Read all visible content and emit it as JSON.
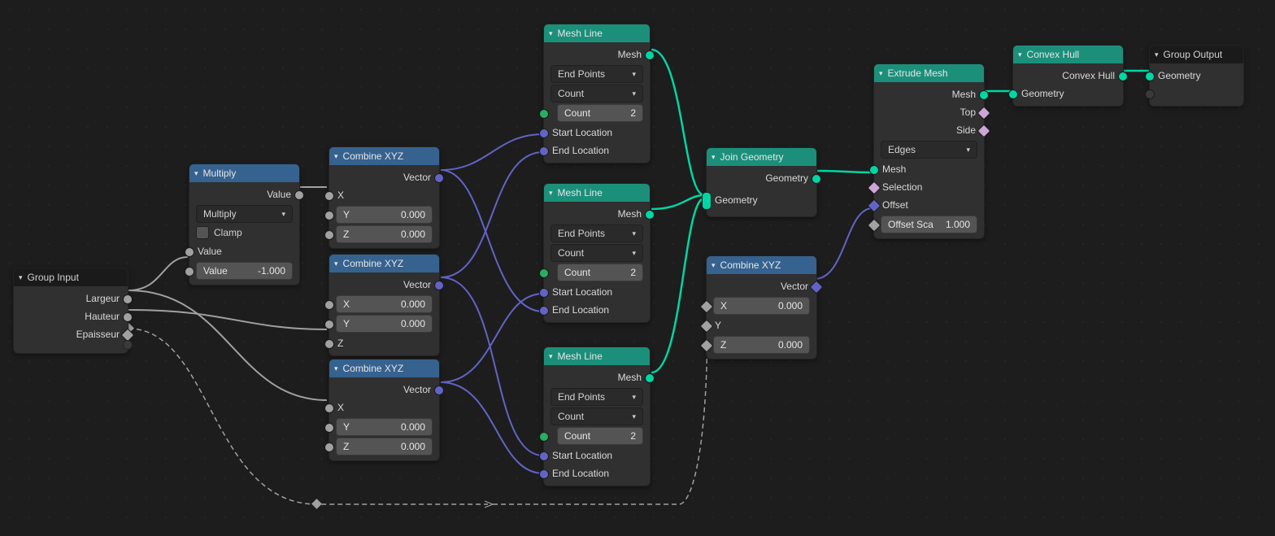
{
  "groupInput": {
    "title": "Group Input",
    "out_largeur": "Largeur",
    "out_hauteur": "Hauteur",
    "out_epaisseur": "Epaisseur"
  },
  "multiply": {
    "title": "Multiply",
    "out_value": "Value",
    "mode": "Multiply",
    "clamp": "Clamp",
    "in_value": "Value",
    "const_value_label": "Value",
    "const_value": "-1.000"
  },
  "combine1": {
    "title": "Combine XYZ",
    "out_vector": "Vector",
    "in_x": "X",
    "y_label": "Y",
    "y_val": "0.000",
    "z_label": "Z",
    "z_val": "0.000"
  },
  "combine2": {
    "title": "Combine XYZ",
    "out_vector": "Vector",
    "x_label": "X",
    "x_val": "0.000",
    "y_label": "Y",
    "y_val": "0.000",
    "in_z": "Z"
  },
  "combine3": {
    "title": "Combine XYZ",
    "out_vector": "Vector",
    "in_x": "X",
    "y_label": "Y",
    "y_val": "0.000",
    "z_label": "Z",
    "z_val": "0.000"
  },
  "meshLine": {
    "title": "Mesh Line",
    "out_mesh": "Mesh",
    "mode1": "End Points",
    "mode2": "Count",
    "count_label": "Count",
    "count_val": "2",
    "in_start": "Start Location",
    "in_end": "End Location"
  },
  "joinGeom": {
    "title": "Join Geometry",
    "out_geometry": "Geometry",
    "in_geometry": "Geometry"
  },
  "combine4": {
    "title": "Combine XYZ",
    "out_vector": "Vector",
    "x_label": "X",
    "x_val": "0.000",
    "in_y": "Y",
    "z_label": "Z",
    "z_val": "0.000"
  },
  "extrude": {
    "title": "Extrude Mesh",
    "out_mesh": "Mesh",
    "out_top": "Top",
    "out_side": "Side",
    "mode": "Edges",
    "in_mesh": "Mesh",
    "in_sel": "Selection",
    "in_off": "Offset",
    "scale_label": "Offset Sca",
    "scale_val": "1.000"
  },
  "convex": {
    "title": "Convex Hull",
    "out": "Convex Hull",
    "in": "Geometry"
  },
  "groupOutput": {
    "title": "Group Output",
    "in_geometry": "Geometry"
  }
}
